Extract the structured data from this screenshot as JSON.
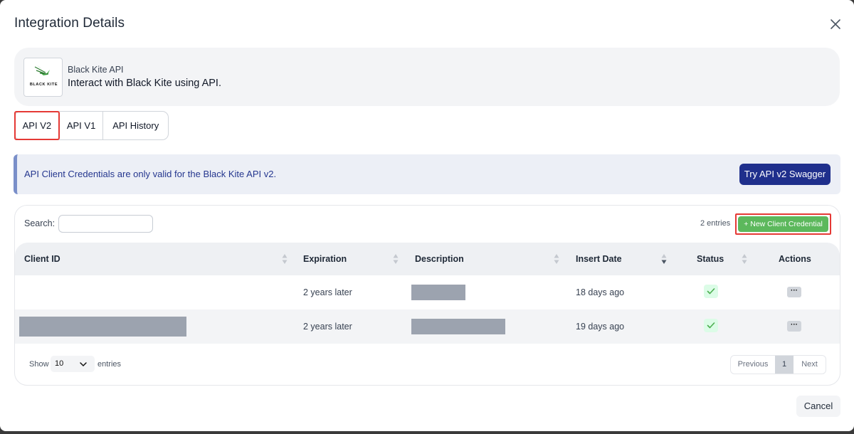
{
  "modal": {
    "title": "Integration Details",
    "close_icon": "close-icon"
  },
  "integration": {
    "logo_text": "BLACK KITE",
    "name": "Black Kite API",
    "description": "Interact with Black Kite using API."
  },
  "tabs": [
    {
      "label": "API V2",
      "active": true
    },
    {
      "label": "API V1",
      "active": false
    },
    {
      "label": "API History",
      "active": false
    }
  ],
  "banner": {
    "text": "API Client Credentials are only valid for the Black Kite API v2.",
    "button_label": "Try API v2 Swagger",
    "accent": "#7a8fc9",
    "button_color": "#1f2f8c"
  },
  "table_toolbar": {
    "search_label": "Search:",
    "search_value": "",
    "entries_count": "2 entries",
    "new_button_label": "+ New Client Credential",
    "new_button_color": "#5cb85c"
  },
  "table": {
    "columns": [
      "Client ID",
      "Expiration",
      "Description",
      "Insert Date",
      "Status",
      "Actions"
    ],
    "rows": [
      {
        "client_id": "",
        "expiration": "2 years later",
        "description": "",
        "insert_date": "18 days ago",
        "status": "active",
        "actions_icon": "more-icon"
      },
      {
        "client_id": "",
        "expiration": "2 years later",
        "description": "",
        "insert_date": "19 days ago",
        "status": "active",
        "actions_icon": "more-icon"
      }
    ]
  },
  "footer": {
    "show_label": "Show",
    "page_size": "10",
    "entries_label": "entries",
    "pagination": {
      "previous": "Previous",
      "current": "1",
      "next": "Next"
    }
  },
  "actions": {
    "cancel_label": "Cancel"
  }
}
